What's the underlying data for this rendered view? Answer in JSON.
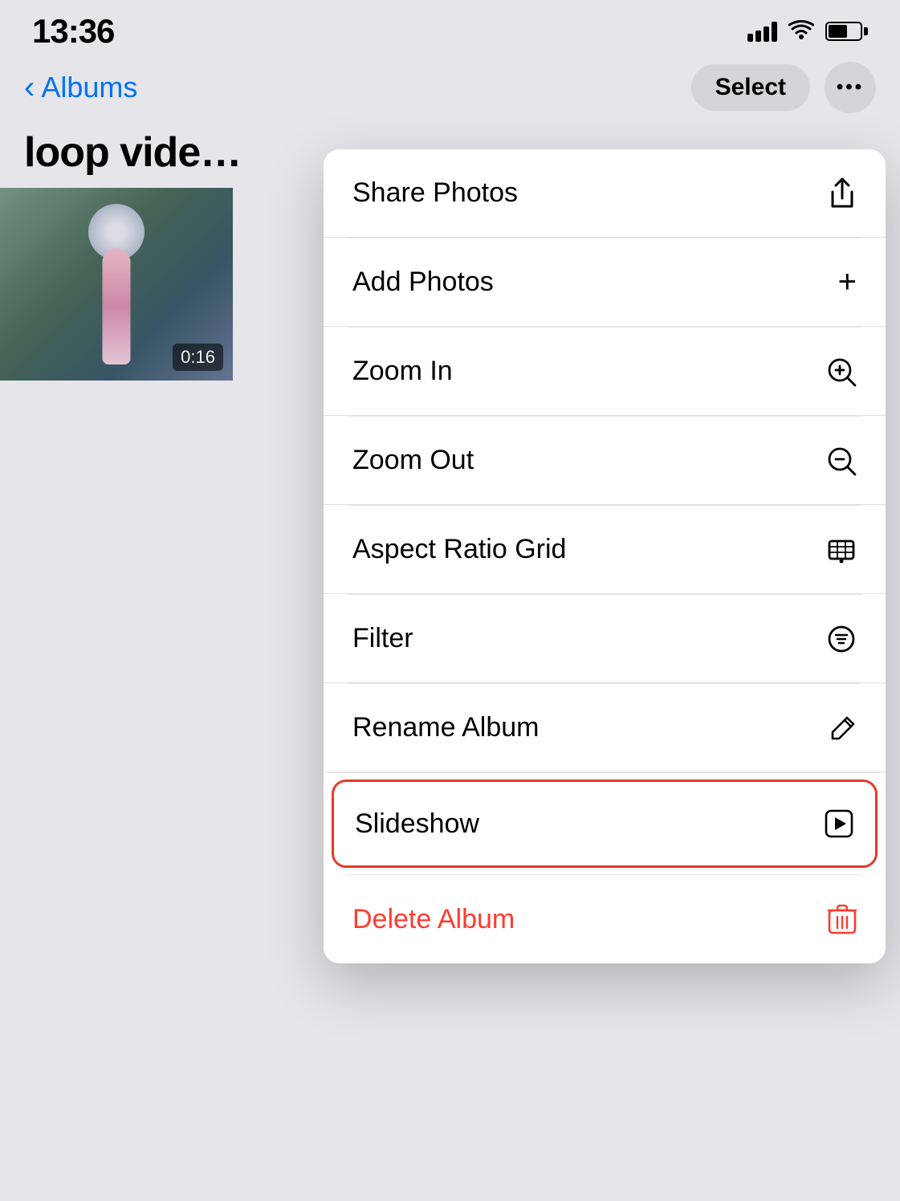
{
  "statusBar": {
    "time": "13:36",
    "signalBars": 4,
    "wifi": true,
    "batteryPercent": 60
  },
  "navBar": {
    "backLabel": "Albums",
    "selectLabel": "Select",
    "moreLabel": "•••"
  },
  "albumTitle": "loop vide",
  "thumbnail": {
    "timestamp": "0:16"
  },
  "menu": {
    "items": [
      {
        "id": "share-photos",
        "label": "Share Photos",
        "icon": "share",
        "red": false
      },
      {
        "id": "add-photos",
        "label": "Add Photos",
        "icon": "plus",
        "red": false
      },
      {
        "id": "zoom-in",
        "label": "Zoom In",
        "icon": "zoom-in",
        "red": false
      },
      {
        "id": "zoom-out",
        "label": "Zoom Out",
        "icon": "zoom-out",
        "red": false
      },
      {
        "id": "aspect-ratio-grid",
        "label": "Aspect Ratio Grid",
        "icon": "aspect-ratio",
        "red": false
      },
      {
        "id": "filter",
        "label": "Filter",
        "icon": "filter",
        "red": false
      },
      {
        "id": "rename-album",
        "label": "Rename Album",
        "icon": "pencil",
        "red": false
      },
      {
        "id": "slideshow",
        "label": "Slideshow",
        "icon": "play",
        "red": false,
        "highlighted": true
      },
      {
        "id": "delete-album",
        "label": "Delete Album",
        "icon": "trash",
        "red": true
      }
    ]
  },
  "colors": {
    "accent": "#007aff",
    "destructive": "#ff3b30",
    "highlight": "#e8392a"
  }
}
